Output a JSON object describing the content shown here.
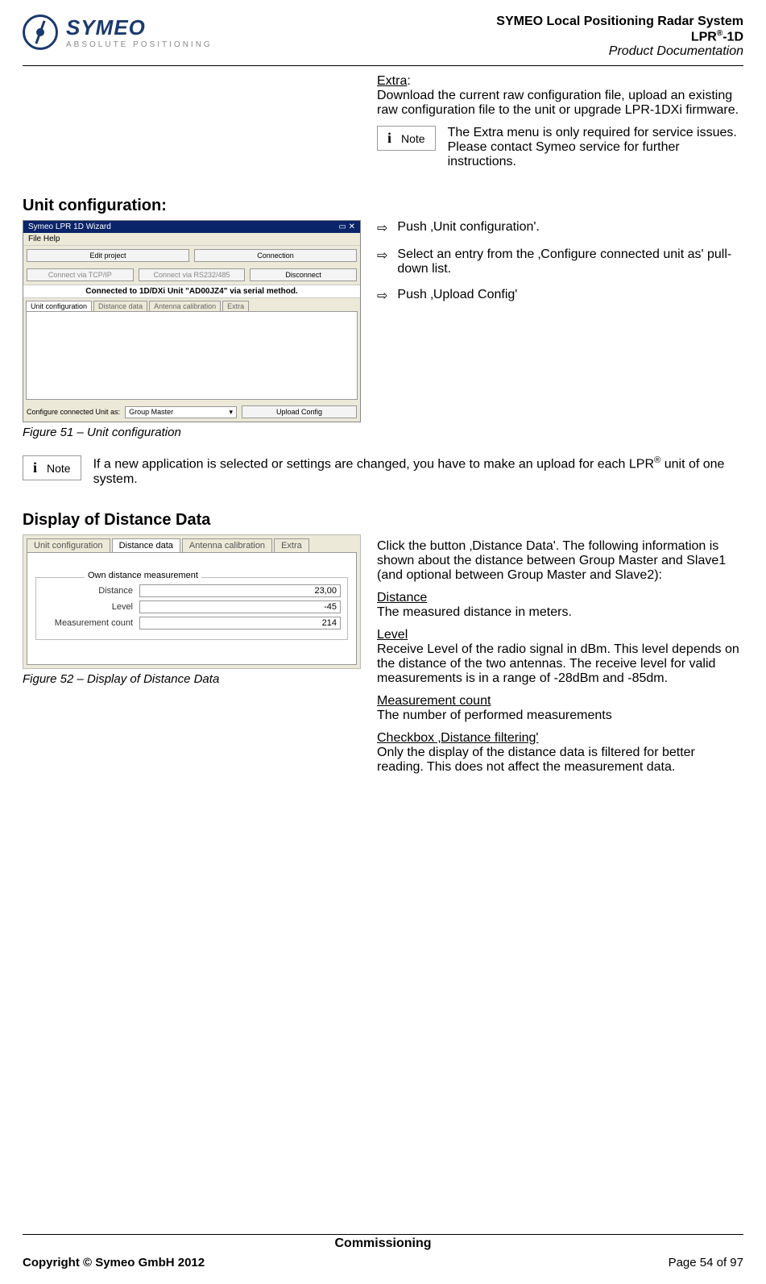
{
  "logo": {
    "name": "SYMEO",
    "tagline": "ABSOLUTE POSITIONING"
  },
  "header": {
    "title1": "SYMEO Local Positioning Radar System",
    "title2_pre": "LPR",
    "title2_sup": "®",
    "title2_post": "-1D",
    "title3": "Product Documentation"
  },
  "extra": {
    "heading": "Extra",
    "colon": ":",
    "text": "Download the current raw configuration file, upload an existing raw configuration file to the unit or upgrade LPR-1DXi firmware.",
    "note_label": "Note",
    "note_text": "The Extra menu is only required for service issues. Please contact Symeo service for further instructions."
  },
  "unit_config": {
    "heading": "Unit configuration:",
    "steps": [
      "Push ‚Unit configuration'.",
      "Select an entry from the ‚Configure connected unit as' pull-down list.",
      "Push ‚Upload Config'"
    ],
    "figure": "Figure 51 – Unit configuration",
    "wizard": {
      "title": "Symeo LPR 1D Wizard",
      "menu": "File   Help",
      "toolbar_edit": "Edit project",
      "toolbar_conn": "Connection",
      "btn_tcp": "Connect via TCP/IP",
      "btn_rs": "Connect via RS232/485",
      "btn_disc": "Disconnect",
      "status": "Connected to 1D/DXi Unit \"AD00JZ4\" via serial method.",
      "tabs": [
        "Unit configuration",
        "Distance data",
        "Antenna calibration",
        "Extra"
      ],
      "bottom_label": "Configure connected Unit as:",
      "bottom_value": "Group Master",
      "bottom_btn": "Upload Config"
    },
    "note2_label": "Note",
    "note2_text_pre": "If a new application is selected or settings are changed, you have to make an upload for each LPR",
    "note2_sup": "®",
    "note2_text_post": " unit of one system."
  },
  "distance": {
    "heading": "Display of Distance Data",
    "figure": "Figure 52 – Display of Distance Data",
    "intro": "Click the button ‚Distance Data'. The following information is shown about the distance between Group Master and Slave1 (and optional between Group Master and Slave2):",
    "defs": [
      {
        "term": "Distance",
        "desc": "The measured distance in meters."
      },
      {
        "term": "Level",
        "desc": "Receive Level of the radio signal in dBm. This level depends on the distance of the two antennas. The receive level for valid measurements is in a range of -28dBm and -85dm."
      },
      {
        "term": "Measurement count",
        "desc": "The number of performed measurements"
      },
      {
        "term": "Checkbox ‚Distance filtering'",
        "desc": "Only the display of the distance data is filtered for better reading. This does not affect the measurement data."
      }
    ],
    "panel": {
      "tabs": [
        "Unit configuration",
        "Distance data",
        "Antenna calibration",
        "Extra"
      ],
      "group_title": "Own distance measurement",
      "rows": [
        {
          "label": "Distance",
          "value": "23,00"
        },
        {
          "label": "Level",
          "value": "-45"
        },
        {
          "label": "Measurement count",
          "value": "214"
        }
      ]
    }
  },
  "footer": {
    "section": "Commissioning",
    "copyright": "Copyright © Symeo GmbH 2012",
    "page": "Page 54 of 97"
  },
  "arrow": "⇨"
}
